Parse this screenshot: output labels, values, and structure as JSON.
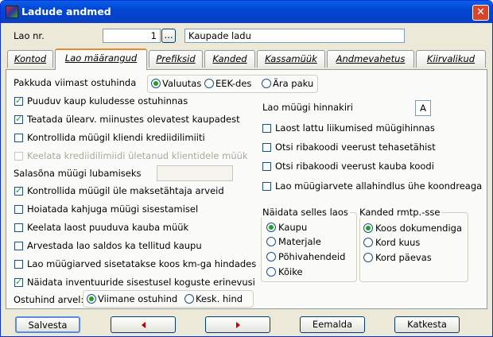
{
  "window": {
    "title": "Ladude andmed",
    "close_glyph": "✕"
  },
  "header": {
    "lao_nr_label": "Lao nr.",
    "lao_nr_value": "1",
    "browse_label": "...",
    "name_value": "Kaupade ladu"
  },
  "tabs": [
    {
      "label": "Kontod",
      "active": false
    },
    {
      "label": "Lao määrangud",
      "active": true
    },
    {
      "label": "Prefiksid",
      "active": false
    },
    {
      "label": "Kanded",
      "active": false
    },
    {
      "label": "Kassamüük",
      "active": false
    },
    {
      "label": "Andmevahetus",
      "active": false
    },
    {
      "label": "Kiirvalikud",
      "active": false
    }
  ],
  "left": {
    "pakkuda_label": "Pakkuda viimast ostuhinda",
    "pakkuda_options": [
      {
        "label": "Valuutas",
        "selected": true
      },
      {
        "label": "EEK-des",
        "selected": false
      },
      {
        "label": "Ära paku",
        "selected": false
      }
    ],
    "checks_top": [
      {
        "label": "Puuduv kaup kuludesse ostuhinnas",
        "checked": true,
        "disabled": false
      },
      {
        "label": "Teatada ülearv. miinustes olevatest kaupadest",
        "checked": true,
        "disabled": false
      },
      {
        "label": "Kontrollida müügil kliendi krediidilimiiti",
        "checked": false,
        "disabled": false
      },
      {
        "label": "Keelata krediidilimiidi ületanud klientidele müük",
        "checked": false,
        "disabled": true
      }
    ],
    "salasona_label": "Salasõna müügi lubamiseks",
    "salasona_value": "",
    "checks_bottom": [
      {
        "label": "Kontrollida müügil üle maksetähtaja arveid",
        "checked": true
      },
      {
        "label": "Hoiatada kahjuga müügi sisestamisel",
        "checked": false
      },
      {
        "label": "Keelata laost puuduva kauba müük",
        "checked": false
      },
      {
        "label": "Arvestada lao saldos ka tellitud kaupu",
        "checked": false
      },
      {
        "label": "Lao müügiarved sisetatakse koos km-ga hindades",
        "checked": false
      },
      {
        "label": "Näidata inventuuride sisestusel koguste erinevusi",
        "checked": true
      }
    ],
    "ostuhind_label": "Ostuhind arvel:",
    "ostuhind_options": [
      {
        "label": "Viimane ostuhind",
        "selected": true
      },
      {
        "label": "Kesk. hind",
        "selected": false
      }
    ]
  },
  "right": {
    "hinnakiri_label": "Lao müügi hinnakiri",
    "hinnakiri_value": "A",
    "checks": [
      {
        "label": "Laost lattu liikumised müügihinnas",
        "checked": false
      },
      {
        "label": "Otsi ribakoodi veerust tehasetähist",
        "checked": false
      },
      {
        "label": "Otsi ribakoodi veerust kauba koodi",
        "checked": false
      },
      {
        "label": "Lao müügiarvete allahindlus ühe koondreaga",
        "checked": false
      }
    ],
    "naidata_title": "Näidata selles laos",
    "naidata_options": [
      {
        "label": "Kaupu",
        "selected": true
      },
      {
        "label": "Materjale",
        "selected": false
      },
      {
        "label": "Põhivahendeid",
        "selected": false
      },
      {
        "label": "Kõike",
        "selected": false
      }
    ],
    "kanded_title": "Kanded rmtp.-sse",
    "kanded_options": [
      {
        "label": "Koos dokumendiga",
        "selected": true
      },
      {
        "label": "Kord kuus",
        "selected": false
      },
      {
        "label": "Kord päevas",
        "selected": false
      }
    ]
  },
  "footer": {
    "save_label": "Salvesta",
    "prev_icon": "arrow-left",
    "next_icon": "arrow-right",
    "delete_label": "Eemalda",
    "cancel_label": "Katkesta"
  }
}
